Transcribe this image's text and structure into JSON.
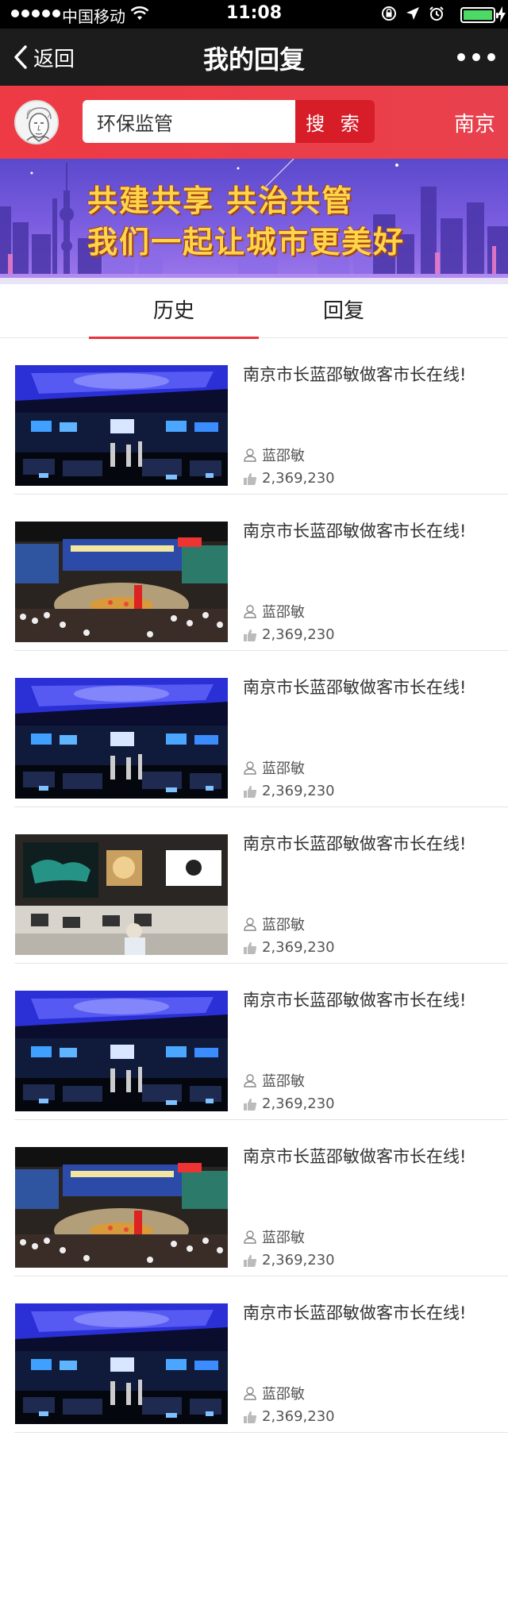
{
  "status_bar": {
    "carrier": "中国移动",
    "time": "11:08",
    "battery_level": 1.0
  },
  "nav": {
    "back_label": "返回",
    "title": "我的回复"
  },
  "search": {
    "value": "环保监管",
    "button_label": "搜 索",
    "city": "南京"
  },
  "banner": {
    "line1": "共建共享  共治共管",
    "line2": "我们一起让城市更美好"
  },
  "tabs": [
    {
      "label": "历史",
      "active": true
    },
    {
      "label": "回复",
      "active": false
    }
  ],
  "items": [
    {
      "title": "南京市长蓝邵敏做客市长在线!",
      "author": "蓝邵敏",
      "likes": "2,369,230",
      "image": "control-room"
    },
    {
      "title": "南京市长蓝邵敏做客市长在线!",
      "author": "蓝邵敏",
      "likes": "2,369,230",
      "image": "conference-hall"
    },
    {
      "title": "南京市长蓝邵敏做客市长在线!",
      "author": "蓝邵敏",
      "likes": "2,369,230",
      "image": "control-room"
    },
    {
      "title": "南京市长蓝邵敏做客市长在线!",
      "author": "蓝邵敏",
      "likes": "2,369,230",
      "image": "monitor-room"
    },
    {
      "title": "南京市长蓝邵敏做客市长在线!",
      "author": "蓝邵敏",
      "likes": "2,369,230",
      "image": "control-room"
    },
    {
      "title": "南京市长蓝邵敏做客市长在线!",
      "author": "蓝邵敏",
      "likes": "2,369,230",
      "image": "conference-hall"
    },
    {
      "title": "南京市长蓝邵敏做客市长在线!",
      "author": "蓝邵敏",
      "likes": "2,369,230",
      "image": "control-room"
    }
  ],
  "colors": {
    "accent": "#e8323c",
    "nav_bg": "#1c1c1c",
    "banner_text": "#ffd54a"
  }
}
